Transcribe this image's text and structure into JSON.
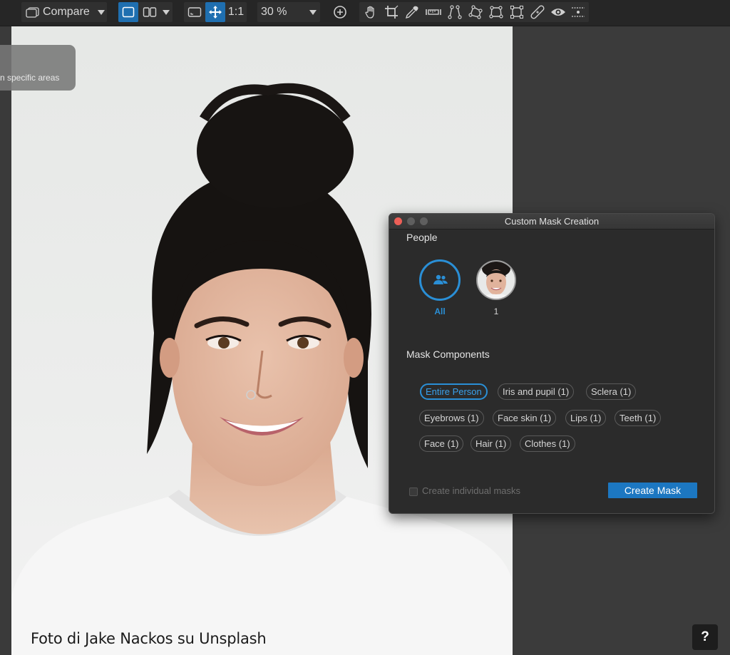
{
  "toolbar": {
    "compare_label": "Compare",
    "zoom_fit_label": "1:1",
    "zoom_value": "30 %",
    "icons": [
      "single-view-icon",
      "split-view-icon",
      "fit-icon",
      "move-icon",
      "zoom-in-icon",
      "hand-icon",
      "crop-icon",
      "eyedropper-icon",
      "straighten-icon",
      "keystone-icon",
      "perspective-icon",
      "lasso-icon",
      "transform-icon",
      "heal-icon",
      "eye-icon",
      "grid-icon"
    ],
    "accent_color": "#1f6fb0"
  },
  "tooltip": {
    "text": "n specific areas"
  },
  "photo": {
    "credit": "Foto di Jake Nackos su Unsplash"
  },
  "help": {
    "label": "?"
  },
  "dialog": {
    "title": "Custom Mask Creation",
    "people_heading": "People",
    "people": [
      {
        "label": "All",
        "icon": "people-icon"
      },
      {
        "label": "1",
        "icon": "face-thumbnail"
      }
    ],
    "components_heading": "Mask Components",
    "components": [
      {
        "label": "Entire Person",
        "selected": true
      },
      {
        "label": "Iris and pupil (1)",
        "selected": false
      },
      {
        "label": "Sclera (1)",
        "selected": false
      },
      {
        "label": "Eyebrows (1)",
        "selected": false
      },
      {
        "label": "Face skin (1)",
        "selected": false
      },
      {
        "label": "Lips (1)",
        "selected": false
      },
      {
        "label": "Teeth (1)",
        "selected": false
      },
      {
        "label": "Face (1)",
        "selected": false
      },
      {
        "label": "Hair (1)",
        "selected": false
      },
      {
        "label": "Clothes (1)",
        "selected": false
      }
    ],
    "individual_masks_label": "Create individual masks",
    "individual_masks_checked": false,
    "create_button": "Create Mask",
    "selection_color": "#2a8fd6",
    "button_color": "#1c77c1"
  }
}
